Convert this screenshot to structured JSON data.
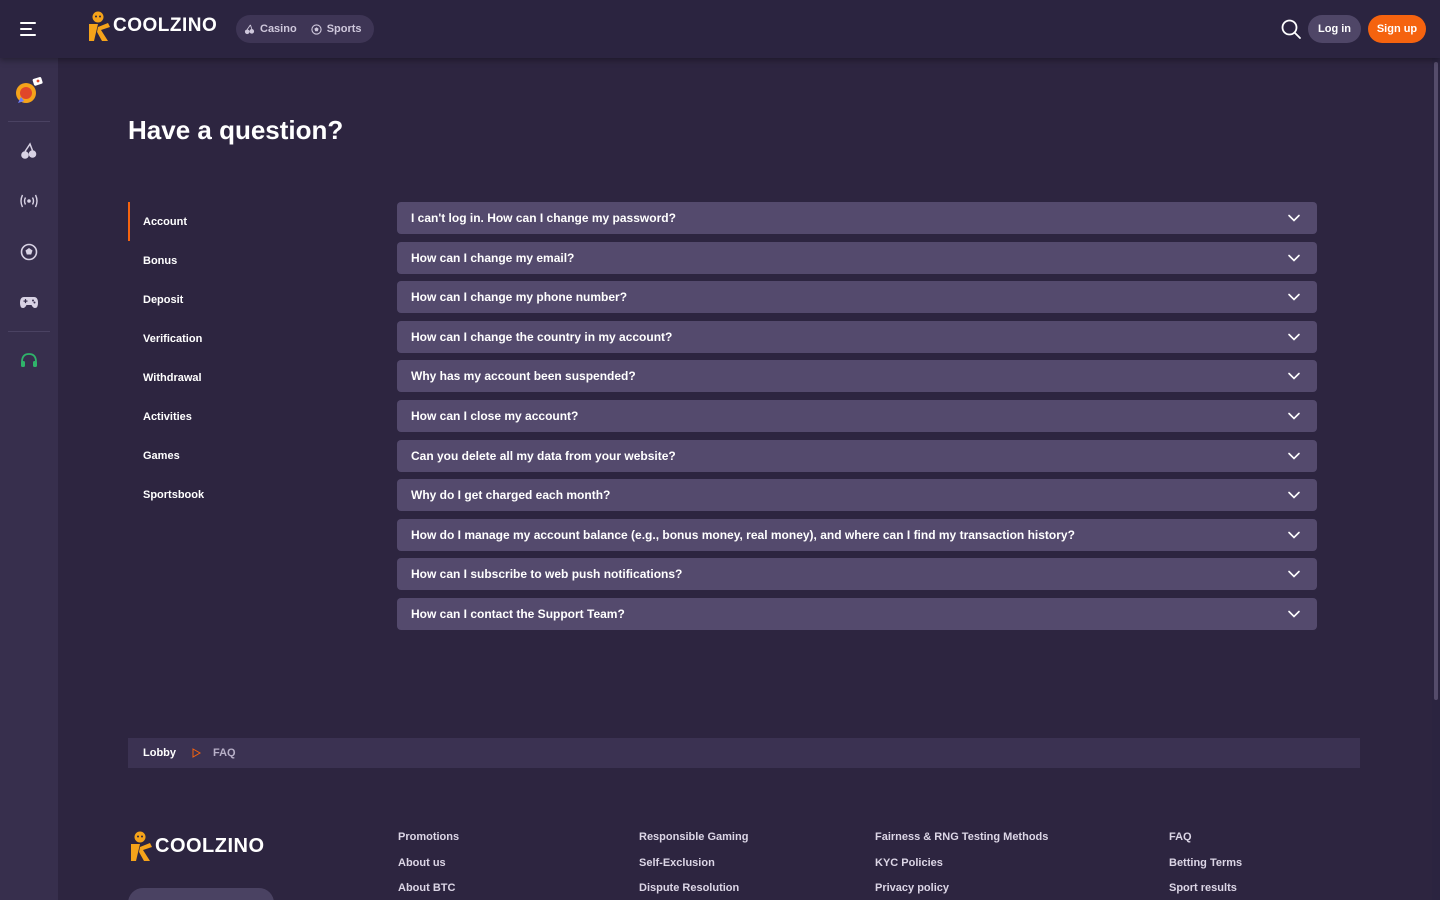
{
  "brand": {
    "name": "COOLZINO",
    "accent": "#f5630f"
  },
  "header": {
    "switch": [
      {
        "label": "Casino",
        "icon": "cherries-icon"
      },
      {
        "label": "Sports",
        "icon": "soccer-ball-icon"
      }
    ],
    "login_label": "Log in",
    "signup_label": "Sign up"
  },
  "rail": {
    "items": [
      "promo-icon",
      "cherries-icon",
      "live-broadcast-icon",
      "soccer-ball-icon",
      "gamepad-icon",
      "support-headset-icon"
    ]
  },
  "page": {
    "title": "Have a question?"
  },
  "categories": [
    {
      "label": "Account",
      "active": true
    },
    {
      "label": "Bonus"
    },
    {
      "label": "Deposit"
    },
    {
      "label": "Verification"
    },
    {
      "label": "Withdrawal"
    },
    {
      "label": "Activities"
    },
    {
      "label": "Games"
    },
    {
      "label": "Sportsbook"
    }
  ],
  "faq": [
    "I can't log in. How can I change my password?",
    "How can I change my email?",
    "How can I change my phone number?",
    "How can I change the country in my account?",
    "Why has my account been suspended?",
    "How can I close my account?",
    "Can you delete all my data from your website?",
    "Why do I get charged each month?",
    "How do I manage my account balance (e.g., bonus money, real money), and where can I find my transaction history?",
    "How can I subscribe to web push notifications?",
    "How can I contact the Support Team?"
  ],
  "breadcrumb": {
    "home": "Lobby",
    "current": "FAQ"
  },
  "footer": {
    "columns": [
      [
        "Promotions",
        "About us",
        "About BTC"
      ],
      [
        "Responsible Gaming",
        "Self-Exclusion",
        "Dispute Resolution"
      ],
      [
        "Fairness & RNG Testing Methods",
        "KYC Policies",
        "Privacy policy"
      ],
      [
        "FAQ",
        "Betting Terms",
        "Sport results"
      ]
    ]
  }
}
